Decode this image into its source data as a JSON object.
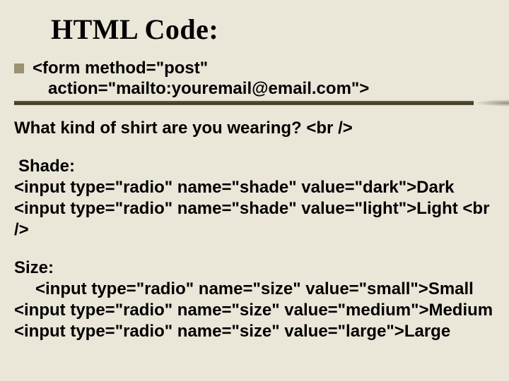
{
  "title": "HTML Code:",
  "bullet": {
    "code": {
      "line1": "<form method=\"post\"",
      "line2": "action=\"mailto:youremail@email.com\">"
    }
  },
  "question": "What kind of shirt are you wearing? <br />",
  "shade": {
    "label": "Shade:",
    "line1": "<input type=\"radio\" name=\"shade\" value=\"dark\">Dark",
    "line2": "<input type=\"radio\" name=\"shade\" value=\"light\">Light <br />"
  },
  "size": {
    "label": "Size:",
    "line1": "<input type=\"radio\" name=\"size\" value=\"small\">Small",
    "line2": "<input type=\"radio\" name=\"size\" value=\"medium\">Medium",
    "line3": "<input type=\"radio\" name=\"size\" value=\"large\">Large"
  }
}
